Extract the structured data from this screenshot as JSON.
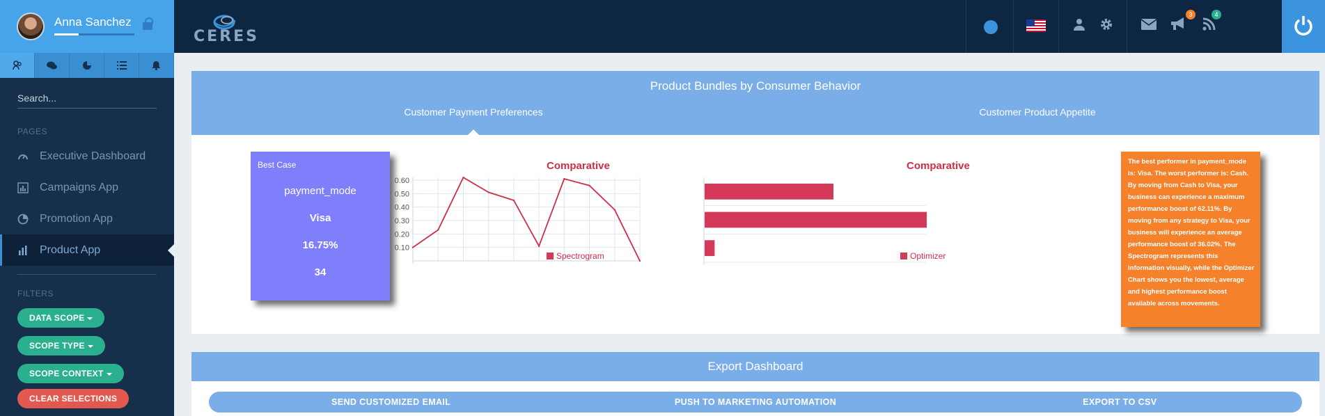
{
  "user": {
    "name": "Anna Sanchez",
    "progress": 0.3
  },
  "sidebar": {
    "tabs": [
      "users-icon",
      "chat-icon",
      "pie-icon",
      "list-icon",
      "bell-icon"
    ],
    "search_placeholder": "Search...",
    "pages_label": "PAGES",
    "items": [
      {
        "label": "Executive Dashboard",
        "icon": "gauge-icon"
      },
      {
        "label": "Campaigns App",
        "icon": "bar-chart-icon"
      },
      {
        "label": "Promotion App",
        "icon": "pie-chart-icon"
      },
      {
        "label": "Product App",
        "icon": "bar-chart-icon"
      }
    ],
    "filters_label": "FILTERS",
    "filters": [
      "DATA SCOPE",
      "SCOPE TYPE",
      "SCOPE CONTEXT"
    ],
    "clear_label": "CLEAR SELECTIONS"
  },
  "topbar": {
    "logo_text": "CERES",
    "notifications": {
      "announcements": "3",
      "feeds": "4"
    }
  },
  "panel": {
    "title": "Product Bundles by Consumer Behavior",
    "tabs": [
      "Customer Payment Preferences",
      "Customer Product Appetite"
    ],
    "best_case": {
      "heading": "Best Case",
      "dimension": "payment_mode",
      "value": "Visa",
      "percent": "16.75%",
      "count": "34"
    },
    "insight": "The best performer in payment_mode is: Visa. The worst performer is: Cash. By moving from Cash to Visa, your business can experience a maximum performance boost of 62.11%. By moving from any strategy to Visa, your business will experience an average performance boost of 36.02%. The Spectrogram represents this information visually, while the Optimizer Chart shows you the lowest, average and highest performance boost available across movements."
  },
  "chart_data": [
    {
      "type": "line",
      "title": "Comparative",
      "series": [
        {
          "name": "Spectrogram",
          "values": [
            0.1,
            0.23,
            0.62,
            0.51,
            0.45,
            0.11,
            0.61,
            0.56,
            0.38,
            0.0
          ]
        }
      ],
      "ylim": [
        0,
        0.6
      ],
      "yticks": [
        "0.10",
        "0.20",
        "0.30",
        "0.40",
        "0.50",
        "0.60"
      ],
      "grid": true,
      "color": "#cf2e47"
    },
    {
      "type": "bar",
      "orientation": "horizontal",
      "title": "Comparative",
      "series": [
        {
          "name": "Optimizer",
          "values": [
            36.02,
            62.11,
            2.8
          ]
        }
      ],
      "xlim": [
        0,
        62.11
      ],
      "color": "#d4395a"
    }
  ],
  "export": {
    "title": "Export Dashboard",
    "actions": [
      "SEND CUSTOMIZED EMAIL",
      "PUSH TO MARKETING AUTOMATION",
      "EXPORT TO CSV"
    ]
  }
}
